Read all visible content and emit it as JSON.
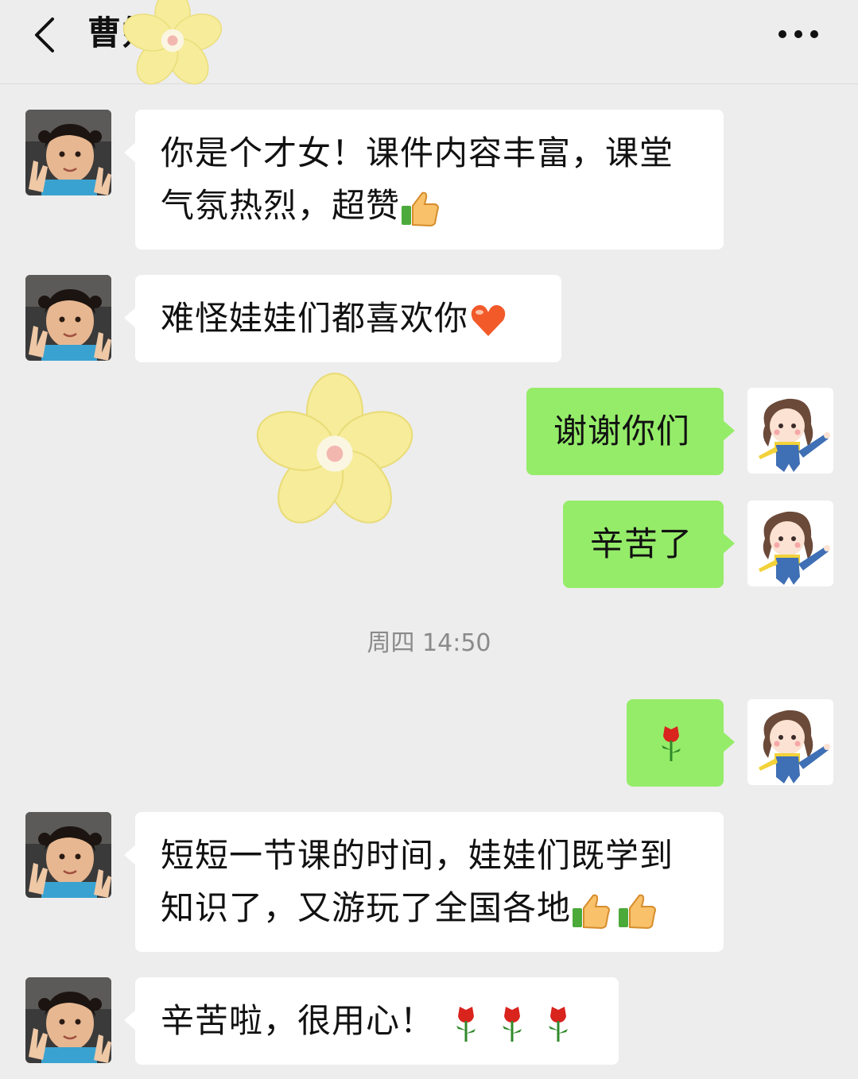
{
  "header": {
    "title": "曹妈妈",
    "back_icon": "chevron-left-icon",
    "more_icon": "more-dots-icon"
  },
  "timestamp": "周四 14:50",
  "messages": [
    {
      "side": "left",
      "text_1": "你是个才女！课件内容丰富，课堂",
      "text_2": "气氛热烈，超赞",
      "emoji": "thumbs-up-icon"
    },
    {
      "side": "left",
      "text": "难怪娃娃们都喜欢你",
      "emoji": "heart-icon"
    },
    {
      "side": "right",
      "text": "谢谢你们"
    },
    {
      "side": "right",
      "text": "辛苦了"
    },
    {
      "side": "right",
      "emoji": "rose-icon"
    },
    {
      "side": "left",
      "text_1": "短短一节课的时间，娃娃们既学到",
      "text_2": "知识了，又游玩了全国各地",
      "emoji": "thumbs-up-icon"
    },
    {
      "side": "left",
      "text": "辛苦啦，很用心！",
      "emoji": "rose-icon"
    }
  ],
  "colors": {
    "background": "#ededed",
    "sent_bubble": "#95ec69",
    "received_bubble": "#ffffff",
    "timestamp": "#8a8a8a"
  }
}
